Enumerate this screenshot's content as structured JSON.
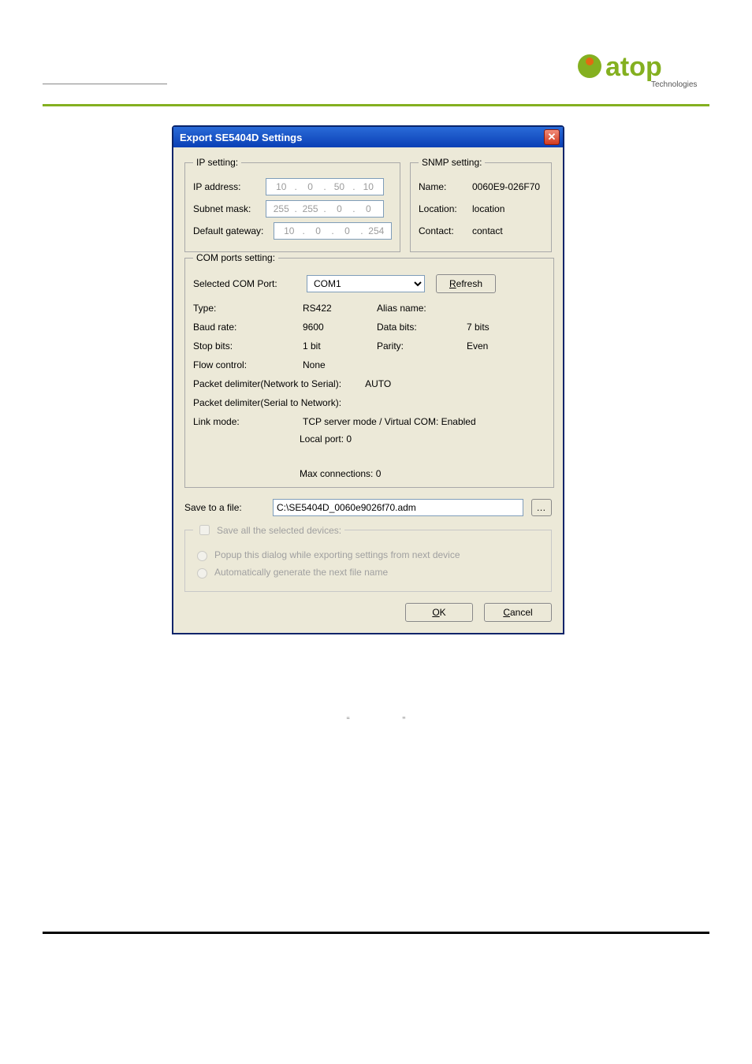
{
  "brand": {
    "name": "atop",
    "sub": "Technologies",
    "accent_green": "#84b020",
    "accent_orange": "#e26a12"
  },
  "dialog": {
    "title": "Export SE5404D Settings",
    "ip_setting": {
      "legend": "IP setting:",
      "rows": {
        "ip_address": {
          "label": "IP address:",
          "o1": "10",
          "o2": "0",
          "o3": "50",
          "o4": "10"
        },
        "subnet_mask": {
          "label": "Subnet mask:",
          "o1": "255",
          "o2": "255",
          "o3": "0",
          "o4": "0"
        },
        "default_gw": {
          "label": "Default gateway:",
          "o1": "10",
          "o2": "0",
          "o3": "0",
          "o4": "254"
        }
      }
    },
    "snmp_setting": {
      "legend": "SNMP setting:",
      "name": {
        "label": "Name:",
        "value": "0060E9-026F70"
      },
      "location": {
        "label": "Location:",
        "value": "location"
      },
      "contact": {
        "label": "Contact:",
        "value": "contact"
      }
    },
    "com_ports": {
      "legend": "COM ports setting:",
      "selected_label": "Selected COM Port:",
      "selected_value": "COM1",
      "refresh_prefix": "R",
      "refresh_rest": "efresh",
      "type": {
        "label": "Type:",
        "value": "RS422"
      },
      "alias": {
        "label": "Alias name:",
        "value": ""
      },
      "baud": {
        "label": "Baud rate:",
        "value": "9600"
      },
      "databits": {
        "label": "Data bits:",
        "value": "7 bits"
      },
      "stopbits": {
        "label": "Stop bits:",
        "value": "1 bit"
      },
      "parity": {
        "label": "Parity:",
        "value": "Even"
      },
      "flow": {
        "label": "Flow control:",
        "value": "None"
      },
      "pkt_n2s": {
        "label": "Packet delimiter(Network to Serial):",
        "value": "AUTO"
      },
      "pkt_s2n": {
        "label": "Packet delimiter(Serial to Network):",
        "value": ""
      },
      "linkmode": {
        "label": "Link mode:",
        "value1": "TCP server mode / Virtual COM: Enabled",
        "value2": "Local port: 0",
        "value3": "Max connections: 0"
      }
    },
    "save": {
      "label": "Save to a file:",
      "value": "C:\\SE5404D_0060e9026f70.adm"
    },
    "save_all": {
      "legend": "Save all the selected devices:",
      "opt_popup": "Popup this dialog while exporting settings from next device",
      "opt_autogen": "Automatically generate the next file name"
    },
    "buttons": {
      "ok_prefix": "O",
      "ok_rest": "K",
      "cancel_prefix": "C",
      "cancel_rest": "ancel"
    }
  }
}
